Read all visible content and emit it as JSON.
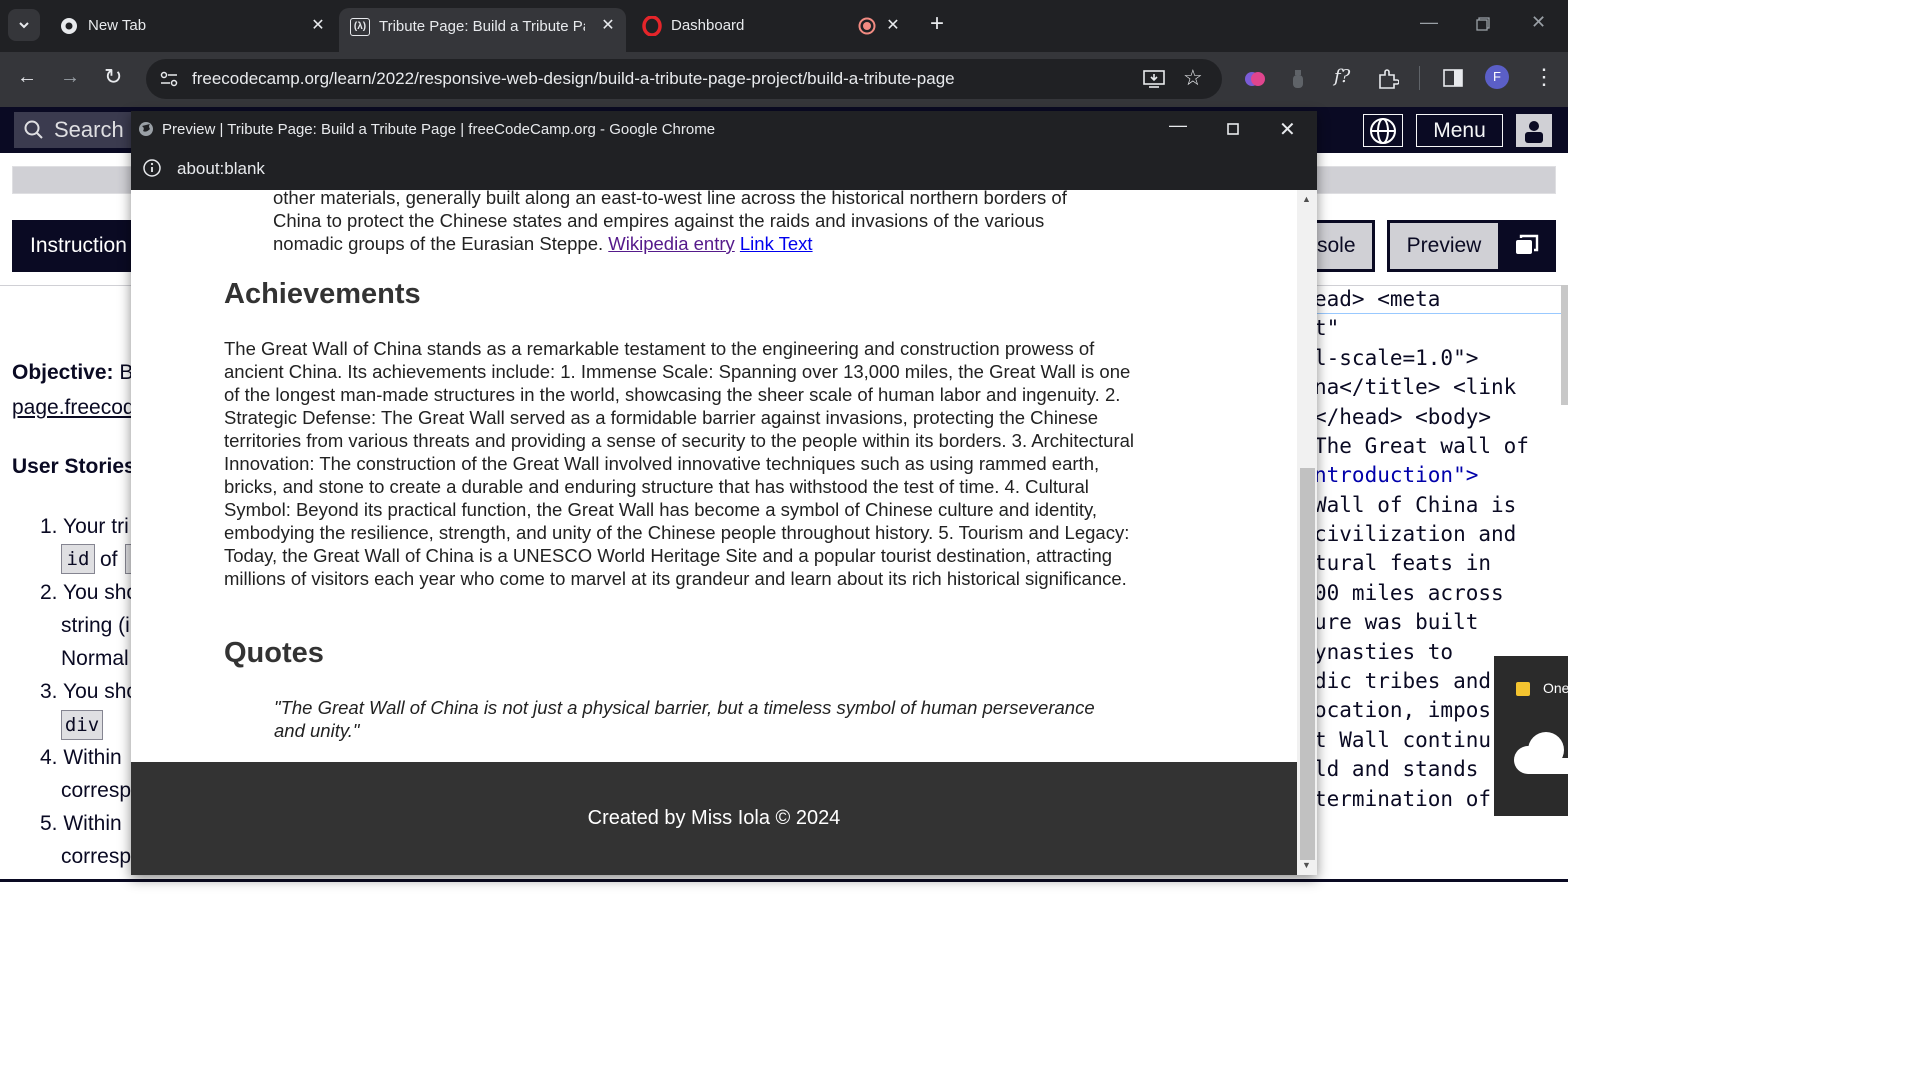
{
  "browser": {
    "tabs": [
      {
        "title": "New Tab"
      },
      {
        "title": "Tribute Page: Build a Tribute Page"
      },
      {
        "title": "Dashboard"
      }
    ],
    "url": "freecodecamp.org/learn/2022/responsive-web-design/build-a-tribute-page-project/build-a-tribute-page",
    "profile_initial": "F"
  },
  "fcc": {
    "search_label": "Search",
    "menu_label": "Menu",
    "instructions_tab": "Instruction",
    "console_tab": "sole",
    "preview_tab": "Preview",
    "objective_label": "Objective:",
    "objective_rest": "B",
    "objective_link": "page.freecod",
    "user_stories_label": "User Stories",
    "stories": [
      {
        "num": "1.",
        "text": "Your tri"
      },
      {
        "num": "2.",
        "text": "You sho"
      },
      {
        "num": "3.",
        "text": "You sho"
      },
      {
        "num": "4.",
        "text": "Within"
      },
      {
        "num": "5.",
        "text": "Within"
      }
    ],
    "story_cont": [
      "of",
      "string (i",
      "Normal",
      "corresp",
      "corresp"
    ],
    "code_chips": [
      "id",
      "div"
    ],
    "code_lines": [
      "ead> <meta",
      "t\"",
      "l-scale=1.0\">",
      "na</title> <link",
      " </head> <body>",
      "The Great wall of",
      "ntroduction\">",
      "Wall of China is",
      " civilization and",
      "tural feats in",
      "00 miles across",
      "ure was built",
      "ynasties to",
      "dic tribes and",
      "ocation, impos",
      "t Wall continu",
      "ld and stands",
      "termination of"
    ],
    "onedrive_label": "One"
  },
  "popup": {
    "window_title": "Preview | Tribute Page: Build a Tribute Page | freeCodeCamp.org - Google Chrome",
    "address": "about:blank",
    "intro_lines": [
      "other materials, generally built along an east-to-west line across the historical northern borders of",
      "China to protect the Chinese states and empires against the raids and invasions of the various"
    ],
    "intro_last": "nomadic groups of the Eurasian Steppe.",
    "wiki_link": "Wikipedia entry",
    "link_text": "Link Text",
    "achievements_heading": "Achievements",
    "achievements_lines": [
      "The Great Wall of China stands as a remarkable testament to the engineering and construction prowess of",
      "ancient China. Its achievements include: 1. Immense Scale: Spanning over 13,000 miles, the Great Wall is one",
      "of the longest man-made structures in the world, showcasing the sheer scale of human labor and ingenuity. 2.",
      "Strategic Defense: The Great Wall served as a formidable barrier against invasions, protecting the Chinese",
      "territories from various threats and providing a sense of security to the people within its borders. 3. Architectural",
      "Innovation: The construction of the Great Wall involved innovative techniques such as using rammed earth,",
      "bricks, and stone to create a durable and enduring structure that has withstood the test of time. 4. Cultural",
      "Symbol: Beyond its practical function, the Great Wall has become a symbol of Chinese culture and identity,",
      "embodying the resilience, strength, and unity of the Chinese people throughout history. 5. Tourism and Legacy:",
      "Today, the Great Wall of China is a UNESCO World Heritage Site and a popular tourist destination, attracting",
      "millions of visitors each year who come to marvel at its grandeur and learn about its rich historical significance."
    ],
    "quotes_heading": "Quotes",
    "quote_lines": [
      "\"The Great Wall of China is not just a physical barrier, but a timeless symbol of human perseverance",
      "and unity.\""
    ],
    "footer": "Created by Miss Iola © 2024"
  }
}
